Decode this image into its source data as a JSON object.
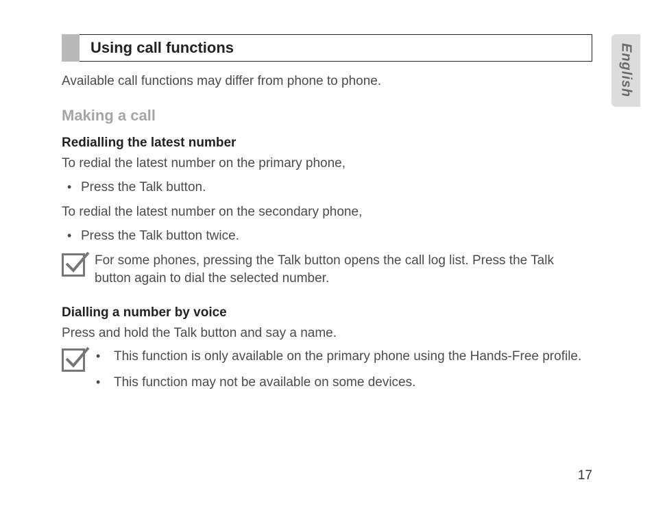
{
  "language_tab": "English",
  "page_number": "17",
  "section_title": "Using call functions",
  "intro": "Available call functions may differ from phone to phone.",
  "subheading": "Making a call",
  "redial": {
    "heading": "Redialling the latest number",
    "primary_text": "To redial the latest number on the primary phone,",
    "primary_bullet": "Press the Talk button.",
    "secondary_text": "To redial the latest number on the secondary phone,",
    "secondary_bullet": "Press the Talk button twice.",
    "note": "For some phones, pressing the Talk button opens the call log list. Press the Talk button again to dial the selected number."
  },
  "voice": {
    "heading": "Dialling a number by voice",
    "text": "Press and hold the Talk button and say a name.",
    "note_bullets": [
      "This function is only available on the primary phone using the Hands-Free profile.",
      "This function may not be available on some devices."
    ]
  }
}
